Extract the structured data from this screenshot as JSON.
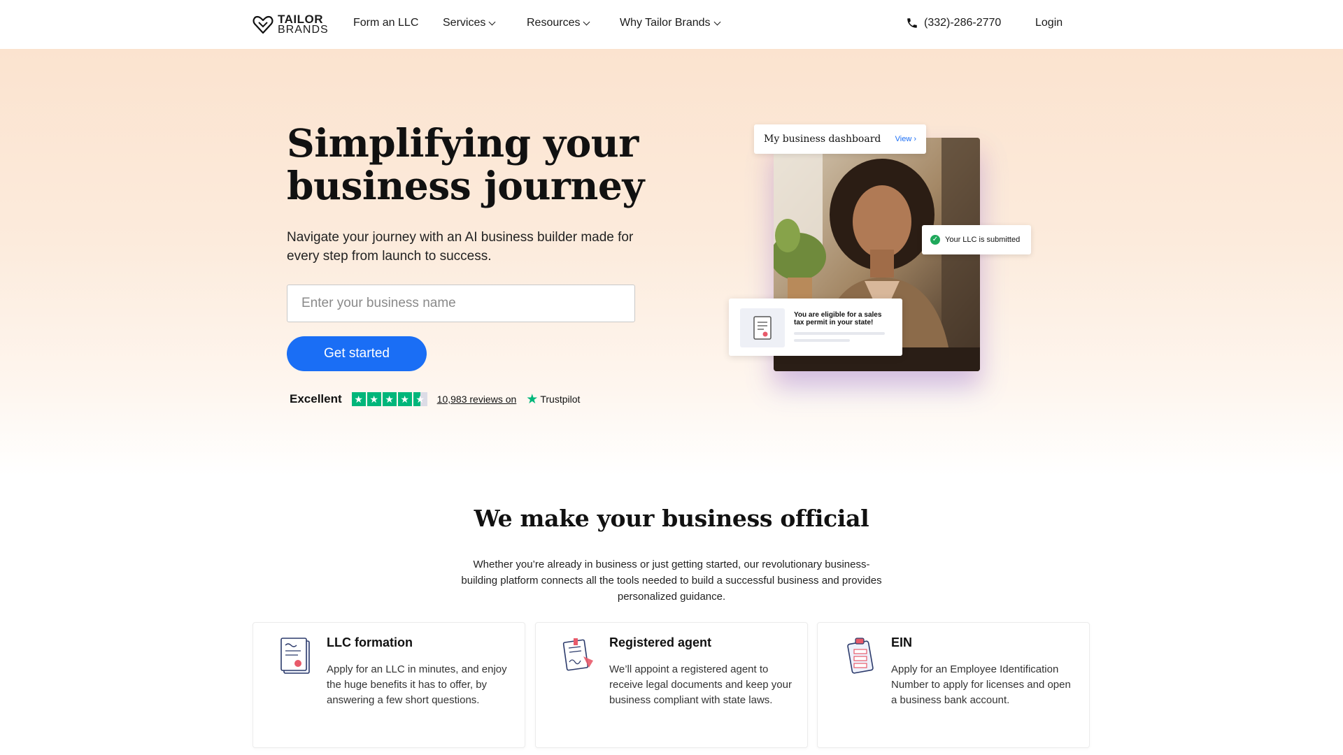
{
  "nav": {
    "logo_line1": "TAILOR",
    "logo_line2": "BRANDS",
    "items": [
      {
        "label": "Form an LLC"
      },
      {
        "label": "Services"
      },
      {
        "label": "Resources"
      },
      {
        "label": "Why Tailor Brands"
      }
    ],
    "phone": "(332)-286-2770",
    "login": "Login"
  },
  "hero": {
    "title": "Simplifying your business journey",
    "subtitle": "Navigate your journey with an AI business builder made for every step from launch to success.",
    "input_placeholder": "Enter your business name",
    "cta": "Get started",
    "trustpilot": {
      "rating_word": "Excellent",
      "stars": 4.5,
      "reviews_text": "10,983 reviews on",
      "brand": "Trustpilot"
    },
    "visual": {
      "dashboard_title": "My business dashboard",
      "dashboard_link": "View ›",
      "llc_status": "Your LLC is submitted",
      "tax_note": "You are eligible for a sales tax permit in your state!"
    }
  },
  "official": {
    "title": "We make your business official",
    "text": "Whether you’re already in business or just getting started, our revolutionary business-building platform connects all the tools needed to build a successful business and provides personalized guidance."
  },
  "features": [
    {
      "title": "LLC formation",
      "text": "Apply for an LLC in minutes, and enjoy the huge benefits it has to offer, by answering a few short questions."
    },
    {
      "title": "Registered agent",
      "text": "We’ll appoint a registered agent to receive legal documents and keep your business compliant with state laws."
    },
    {
      "title": "EIN",
      "text": "Apply for an Employee Identification Number to apply for licenses and open a business bank account."
    }
  ],
  "colors": {
    "accent": "#1a6ef5",
    "trustpilot_green": "#00b67a",
    "success_green": "#1fa85b",
    "hero_bg_top": "#fbe3cf"
  }
}
